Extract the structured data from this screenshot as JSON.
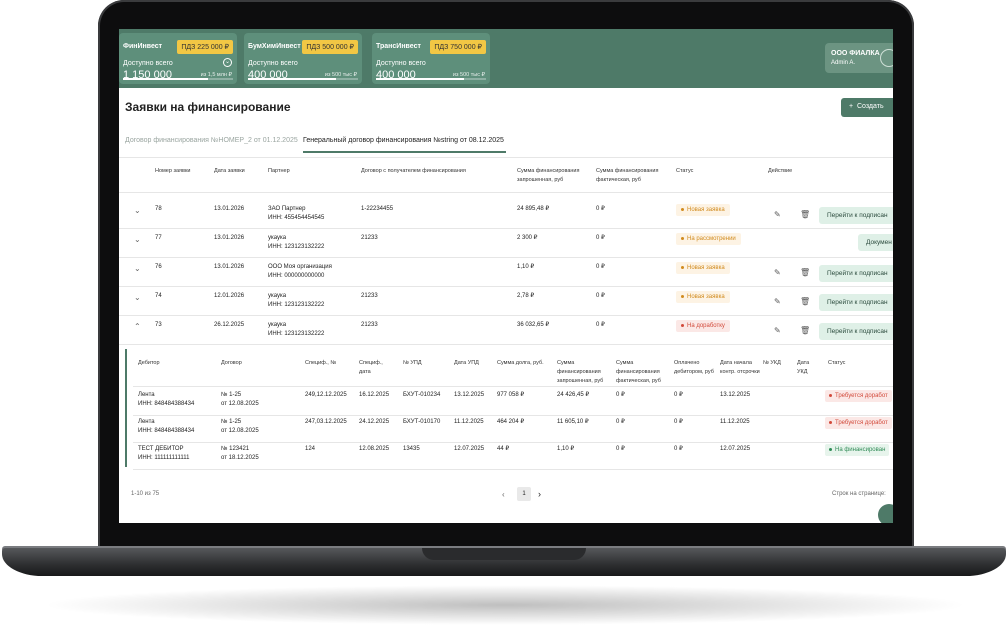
{
  "cards": [
    {
      "name": "ФинИнвест",
      "badge": "ПДЗ 225 000 ₽",
      "label": "Доступно всего",
      "value": "1 150 000",
      "limit": "из 1,5 млн ₽",
      "fill": 0.77
    },
    {
      "name": "БумХимИнвест",
      "badge": "ПДЗ 500 000 ₽",
      "label": "Доступно всего",
      "value": "400 000",
      "limit": "из 500 тыс ₽",
      "fill": 0.8
    },
    {
      "name": "ТрансИнвест",
      "badge": "ПДЗ 750 000 ₽",
      "label": "Доступно всего",
      "value": "400 000",
      "limit": "из 500 тыс ₽",
      "fill": 0.8
    }
  ],
  "org": {
    "name": "ООО ФИАЛКА",
    "user": "Admin A."
  },
  "page": {
    "title": "Заявки на финансирование",
    "create": "Создать"
  },
  "tabs": [
    "Договор финансирования №НОМЕР_2 от 01.12.2025",
    "Генеральный договор финансирования №string от 08.12.2025"
  ],
  "table": {
    "headers": [
      "Номер заявки",
      "Дата заявки",
      "Партнер",
      "Договор с получателем финансирования",
      "Сумма финансирования запрошенная, руб",
      "Сумма финансирования фактическая, руб",
      "Статус",
      "Действие"
    ],
    "rows": [
      {
        "num": "78",
        "date": "13.01.2026",
        "partner": "ЗАО Партнер",
        "inn": "ИНН: 455454454545",
        "contract": "1-22234455",
        "req": "24 895,48 ₽",
        "fact": "0 ₽",
        "status": "Новая заявка",
        "action": "Перейти к подписан"
      },
      {
        "num": "77",
        "date": "13.01.2026",
        "partner": "укаука",
        "inn": "ИНН: 123123132222",
        "contract": "21233",
        "req": "2 300 ₽",
        "fact": "0 ₽",
        "status": "На рассмотрении",
        "action": "Докумен"
      },
      {
        "num": "76",
        "date": "13.01.2026",
        "partner": "ООО Моя организация",
        "inn": "ИНН: 000000000000",
        "contract": "",
        "req": "1,10 ₽",
        "fact": "0 ₽",
        "status": "Новая заявка",
        "action": "Перейти к подписан"
      },
      {
        "num": "74",
        "date": "12.01.2026",
        "partner": "укаука",
        "inn": "ИНН: 123123132222",
        "contract": "21233",
        "req": "2,78 ₽",
        "fact": "0 ₽",
        "status": "Новая заявка",
        "action": "Перейти к подписан"
      },
      {
        "num": "73",
        "date": "26.12.2025",
        "partner": "укаука",
        "inn": "ИНН: 123123132222",
        "contract": "21233",
        "req": "36 032,65 ₽",
        "fact": "0 ₽",
        "status": "На доработку",
        "action": "Перейти к подписан"
      }
    ]
  },
  "sub": {
    "headers": [
      "Дебитор",
      "Договор",
      "Специф., №",
      "Специф., дата",
      "№ УПД",
      "Дата УПД",
      "Сумма долга, руб.",
      "Сумма финансирования запрошенная, руб",
      "Сумма финансирования фактическая, руб",
      "Оплачено дебитором, руб",
      "Дата начала контр. отсрочки",
      "№ УКД",
      "Дата УКД",
      "Статус"
    ],
    "rows": [
      {
        "deb": "Лента",
        "inn": "ИНН: 848484388434",
        "dog": "№ 1-25",
        "dogdate": "от 12.08.2025",
        "specn": "249,12.12.2025",
        "specd": "16.12.2025",
        "upd": "БХУТ-010234",
        "upddate": "13.12.2025",
        "debt": "977 058 ₽",
        "req": "24 426,45 ₽",
        "fact": "0 ₽",
        "paid": "0 ₽",
        "start": "13.12.2025",
        "status": "Требуется доработ"
      },
      {
        "deb": "Лента",
        "inn": "ИНН: 848484388434",
        "dog": "№ 1-25",
        "dogdate": "от 12.08.2025",
        "specn": "247,03.12.2025",
        "specd": "24.12.2025",
        "upd": "БХУТ-010170",
        "upddate": "11.12.2025",
        "debt": "464 204 ₽",
        "req": "11 605,10 ₽",
        "fact": "0 ₽",
        "paid": "0 ₽",
        "start": "11.12.2025",
        "status": "Требуется доработ"
      },
      {
        "deb": "ТЕСТ ДЕБИТОР",
        "inn": "ИНН: 111111111111",
        "dog": "№ 123421",
        "dogdate": "от 18.12.2025",
        "specn": "124",
        "specd": "12.08.2025",
        "upd": "13435",
        "upddate": "12.07.2025",
        "debt": "44 ₽",
        "req": "1,10 ₽",
        "fact": "0 ₽",
        "paid": "0 ₽",
        "start": "12.07.2025",
        "status": "На финансирован"
      }
    ]
  },
  "footer": {
    "range": "1-10 из 75",
    "page": "1",
    "perpage": "Строк на странице:"
  },
  "colors": {
    "brand": "#4e7a68",
    "card": "#5e8f7b",
    "badge": "#f2c744"
  }
}
